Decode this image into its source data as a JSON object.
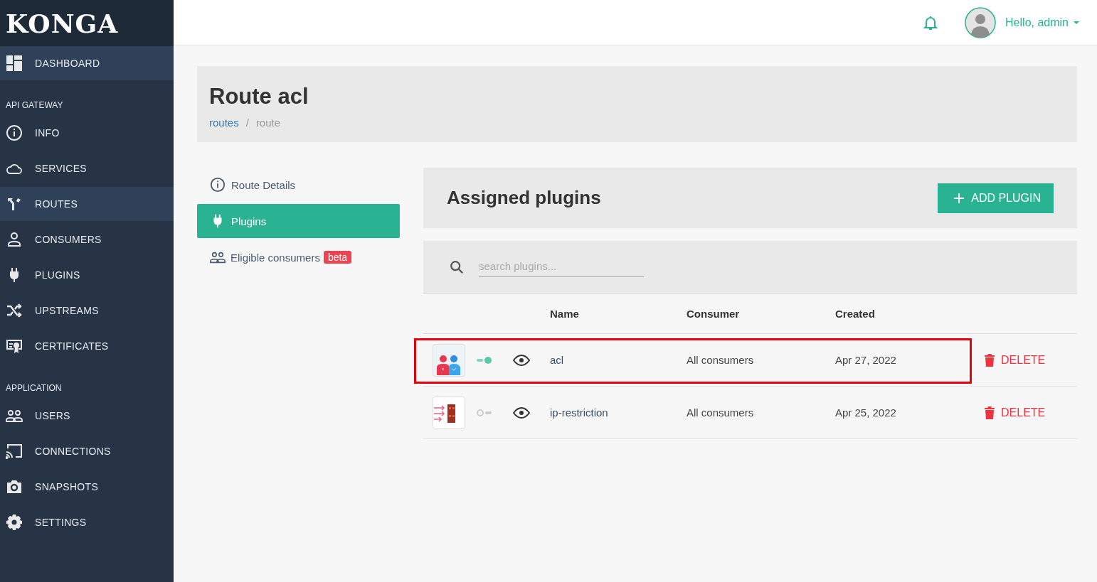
{
  "logo": "KONGA",
  "topbar": {
    "greeting": "Hello, admin"
  },
  "sidebar": [
    {
      "items": [
        {
          "label": "DASHBOARD",
          "selected": true
        }
      ]
    },
    {
      "heading": "API GATEWAY",
      "items": [
        {
          "label": "INFO",
          "selected": false
        },
        {
          "label": "SERVICES",
          "selected": false
        },
        {
          "label": "ROUTES",
          "selected": true
        },
        {
          "label": "CONSUMERS",
          "selected": false
        },
        {
          "label": "PLUGINS",
          "selected": false
        },
        {
          "label": "UPSTREAMS",
          "selected": false
        },
        {
          "label": "CERTIFICATES",
          "selected": false
        }
      ]
    },
    {
      "heading": "APPLICATION",
      "items": [
        {
          "label": "USERS",
          "selected": false
        },
        {
          "label": "CONNECTIONS",
          "selected": false
        },
        {
          "label": "SNAPSHOTS",
          "selected": false
        },
        {
          "label": "SETTINGS",
          "selected": false
        }
      ]
    }
  ],
  "page": {
    "title": "Route acl",
    "breadcrumb_separator": "/",
    "breadcrumb": [
      {
        "label": "routes",
        "link": true
      },
      {
        "label": "route",
        "link": false
      }
    ]
  },
  "tabs": [
    {
      "label": "Route Details",
      "selected": false
    },
    {
      "label": "Plugins",
      "selected": true
    },
    {
      "label": "Eligible consumers",
      "selected": false,
      "badge": "beta"
    }
  ],
  "panel": {
    "title": "Assigned plugins",
    "add_button": "ADD PLUGIN",
    "search": {
      "placeholder": "search plugins..."
    }
  },
  "table": {
    "columns": [
      "Name",
      "Consumer",
      "Created"
    ],
    "rows": [
      {
        "name": "acl",
        "consumer": "All consumers",
        "created": "Apr 27, 2022",
        "enabled": true,
        "highlighted": true,
        "action": "DELETE"
      },
      {
        "name": "ip-restriction",
        "consumer": "All consumers",
        "created": "Apr 25, 2022",
        "enabled": false,
        "highlighted": false,
        "action": "DELETE"
      }
    ]
  }
}
